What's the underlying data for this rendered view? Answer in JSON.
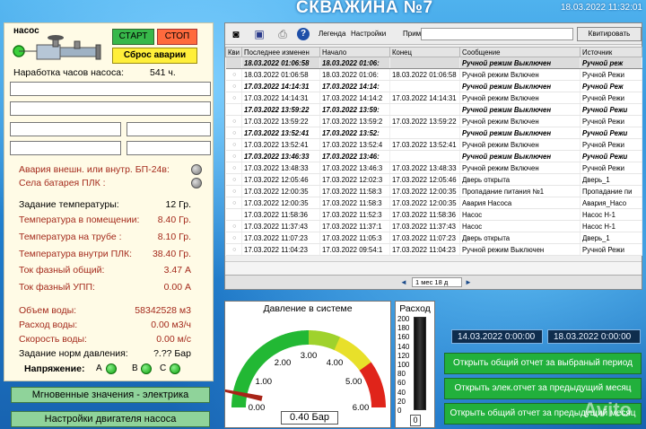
{
  "header": {
    "title": "СКВАЖИНА №7",
    "datetime": "18.03.2022 11:32:01"
  },
  "pump": {
    "label": "насос",
    "start_label": "СТАРТ",
    "stop_label": "СТОП",
    "reset_label": "Сброс аварии",
    "hours_label": "Наработка часов насоса:",
    "hours_value": "541 ч.",
    "alarm_power_label": "Авария внешн. или внутр. БП-24в:",
    "alarm_battery_label": "Села батарея ПЛК :",
    "params": [
      {
        "label": "Задание температуры:",
        "value": "12 Гр.",
        "red": false
      },
      {
        "label": "Температура в помещении:",
        "value": "8.40 Гр.",
        "red": true
      },
      {
        "label": "Температура на трубе :",
        "value": "8.10 Гр.",
        "red": true
      },
      {
        "label": "Температура внутри  ПЛК:",
        "value": "38.40 Гр.",
        "red": true
      },
      {
        "label": "Ток фазный общий:",
        "value": "3.47 А",
        "red": true
      },
      {
        "label": "Ток фазный УПП:",
        "value": "0.00 А",
        "red": true
      }
    ],
    "water": [
      {
        "label": "Объем  воды:",
        "value": "58342528 м3"
      },
      {
        "label": "Расход воды:",
        "value": "0.00 м3/ч"
      },
      {
        "label": "Скорость воды:",
        "value": "0.00 м/с"
      },
      {
        "label": "Задание норм давления:",
        "value": "?.?? Бар"
      }
    ],
    "voltage_label": "Напряжение:",
    "phase_a": "A",
    "phase_b": "B",
    "phase_c": "C",
    "btn_electric": "Мгновенные значения - электрика",
    "btn_motor": "Настройки двигателя насоса"
  },
  "log": {
    "toolbar": {
      "legend_label": "Легенда",
      "settings_label": "Настройки",
      "note_label": "Прим.",
      "ack_button": "Квитировать"
    },
    "columns": [
      "Кви",
      "Последнее изменен",
      "Начало",
      "Конец",
      "Сообщение",
      "Источник"
    ],
    "rows": [
      {
        "changed": "18.03.2022 01:06:58",
        "start": "18.03.2022 01:06:",
        "end": "",
        "message": "Ручной режим Выключен",
        "source": "Ручной реж",
        "bold": true,
        "selected": true,
        "icon": ""
      },
      {
        "changed": "18.03.2022 01:06:58",
        "start": "18.03.2022 01:06:",
        "end": "18.03.2022 01:06:58",
        "message": "Ручной режим Включен",
        "source": "Ручной Режи",
        "bold": false,
        "selected": false,
        "icon": "○"
      },
      {
        "changed": "17.03.2022 14:14:31",
        "start": "17.03.2022 14:14:",
        "end": "",
        "message": "Ручной режим Выключен",
        "source": "Ручной Реж",
        "bold": true,
        "selected": false,
        "icon": "○"
      },
      {
        "changed": "17.03.2022 14:14:31",
        "start": "17.03.2022 14:14:2",
        "end": "17.03.2022 14:14:31",
        "message": "Ручной режим Включен",
        "source": "Ручной Режи",
        "bold": false,
        "selected": false,
        "icon": "○"
      },
      {
        "changed": "17.03.2022 13:59:22",
        "start": "17.03.2022 13:59:",
        "end": "",
        "message": "Ручной режим Выключен",
        "source": "Ручной Режи",
        "bold": true,
        "selected": false,
        "icon": ""
      },
      {
        "changed": "17.03.2022 13:59:22",
        "start": "17.03.2022 13:59:2",
        "end": "17.03.2022 13:59:22",
        "message": "Ручной режим Включен",
        "source": "Ручной Режи",
        "bold": false,
        "selected": false,
        "icon": "○"
      },
      {
        "changed": "17.03.2022 13:52:41",
        "start": "17.03.2022 13:52:",
        "end": "",
        "message": "Ручной режим Выключен",
        "source": "Ручной Режи",
        "bold": true,
        "selected": false,
        "icon": "○"
      },
      {
        "changed": "17.03.2022 13:52:41",
        "start": "17.03.2022 13:52:4",
        "end": "17.03.2022 13:52:41",
        "message": "Ручной режим Включен",
        "source": "Ручной Режи",
        "bold": false,
        "selected": false,
        "icon": "○"
      },
      {
        "changed": "17.03.2022 13:46:33",
        "start": "17.03.2022 13:46:",
        "end": "",
        "message": "Ручной режим Выключен",
        "source": "Ручной Режи",
        "bold": true,
        "selected": false,
        "icon": "○"
      },
      {
        "changed": "17.03.2022 13:48:33",
        "start": "17.03.2022 13:46:3",
        "end": "17.03.2022 13:48:33",
        "message": "Ручной режим Включен",
        "source": "Ручной Режи",
        "bold": false,
        "selected": false,
        "icon": "○"
      },
      {
        "changed": "17.03.2022 12:05:46",
        "start": "17.03.2022 12:02:3",
        "end": "17.03.2022 12:05:46",
        "message": "Дверь открыта",
        "source": "Дверь_1",
        "bold": false,
        "selected": false,
        "icon": "○"
      },
      {
        "changed": "17.03.2022 12:00:35",
        "start": "17.03.2022 11:58:3",
        "end": "17.03.2022 12:00:35",
        "message": "Пропадание питания №1",
        "source": "Пропадание пи",
        "bold": false,
        "selected": false,
        "icon": "○"
      },
      {
        "changed": "17.03.2022 12:00:35",
        "start": "17.03.2022 11:58:3",
        "end": "17.03.2022 12:00:35",
        "message": "Авария Насоса",
        "source": "Авария_Насо",
        "bold": false,
        "selected": false,
        "icon": "○"
      },
      {
        "changed": "17.03.2022 11:58:36",
        "start": "17.03.2022 11:52:3",
        "end": "17.03.2022 11:58:36",
        "message": "Насос",
        "source": "Насос Н-1",
        "bold": false,
        "selected": false,
        "icon": ""
      },
      {
        "changed": "17.03.2022 11:37:43",
        "start": "17.03.2022 11:37:1",
        "end": "17.03.2022 11:37:43",
        "message": "Насос",
        "source": "Насос Н-1",
        "bold": false,
        "selected": false,
        "icon": "○"
      },
      {
        "changed": "17.03.2022 11:07:23",
        "start": "17.03.2022 11:05:3",
        "end": "17.03.2022 11:07:23",
        "message": "Дверь открыта",
        "source": "Дверь_1",
        "bold": false,
        "selected": false,
        "icon": "○"
      },
      {
        "changed": "17.03.2022 11:04:23",
        "start": "17.03.2022 09:54:1",
        "end": "17.03.2022 11:04:23",
        "message": "Ручной режим Выключен",
        "source": "Ручной Режи",
        "bold": false,
        "selected": false,
        "icon": "○"
      }
    ],
    "range_label": "1 мес 18 д"
  },
  "gauge": {
    "title": "Давление в системе",
    "readout": "0.40 Бар",
    "value": 0.4,
    "min": 0,
    "max": 6,
    "ticks": [
      "0.00",
      "1.00",
      "2.00",
      "3.00",
      "4.00",
      "5.00",
      "6.00"
    ],
    "colors": {
      "green": "#22b834",
      "yellow": "#e8e02a",
      "red": "#e0241a",
      "needle": "#a82418"
    }
  },
  "flow": {
    "title": "Расход",
    "ticks": [
      "200",
      "180",
      "160",
      "140",
      "120",
      "100",
      "80",
      "60",
      "40",
      "20",
      "0"
    ],
    "readout": "0",
    "value": 0
  },
  "reports": {
    "date_from": "14.03.2022 0:00:00",
    "date_to": "18.03.2022 0:00:00",
    "btn_period": "Открыть общий отчет за  выбраный  период",
    "btn_elec_month": "Открыть элек.отчет за предыдущий месяц",
    "btn_general_month": "Открыть общий отчет  за предыдущий месяц"
  },
  "watermark": "Avito"
}
